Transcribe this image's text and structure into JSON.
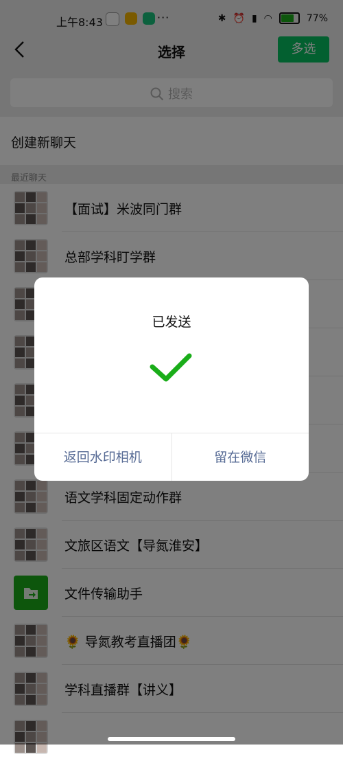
{
  "status_bar": {
    "time": "上午8:43",
    "more": "···",
    "battery": "77%"
  },
  "header": {
    "title": "选择",
    "multi_select": "多选"
  },
  "search": {
    "placeholder": "搜索"
  },
  "new_chat": "创建新聊天",
  "section_recent": "最近聊天",
  "chats": [
    "【面试】米波同门群",
    "总部学科盯学群",
    "",
    "",
    "",
    "",
    "语文学科固定动作群",
    "文旅区语文【导氮淮安】",
    "文件传输助手",
    "🌻 导氮教考直播团🌻",
    "学科直播群【讲义】"
  ],
  "dialog": {
    "title": "已发送",
    "left_button": "返回水印相机",
    "right_button": "留在微信"
  },
  "colors": {
    "wechat_green": "#07c160",
    "link_blue": "#576b95"
  }
}
